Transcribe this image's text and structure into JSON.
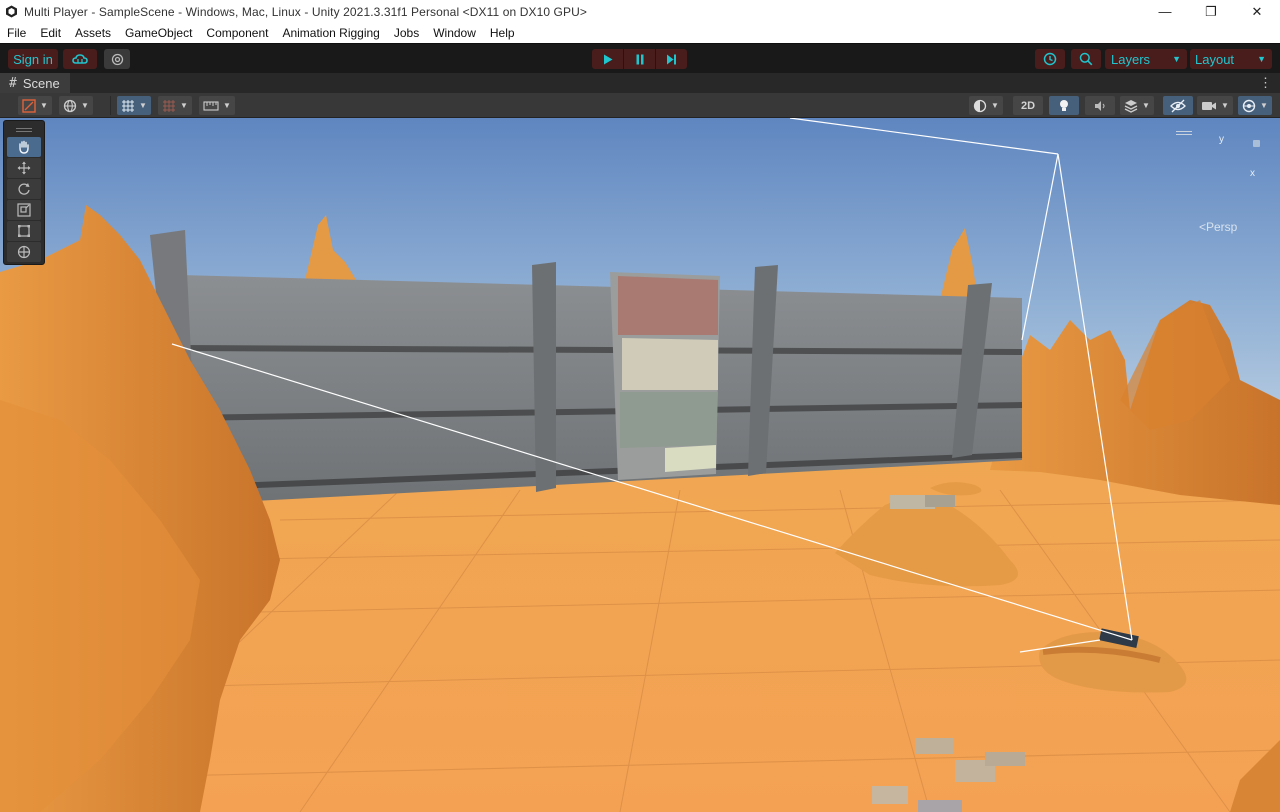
{
  "window": {
    "title": "Multi Player - SampleScene - Windows, Mac, Linux - Unity 2021.3.31f1 Personal <DX11 on DX10 GPU>",
    "controls": {
      "minimize": "—",
      "maximize": "❐",
      "close": "✕"
    }
  },
  "menubar": {
    "items": [
      "File",
      "Edit",
      "Assets",
      "GameObject",
      "Component",
      "Animation Rigging",
      "Jobs",
      "Window",
      "Help"
    ]
  },
  "toolbar": {
    "sign_in": "Sign in",
    "layers": "Layers",
    "layout": "Layout",
    "colors": {
      "background": "#191919",
      "accent": "#1fc4cc",
      "playmode_tint": "#4a1d1d"
    }
  },
  "scene_tab": {
    "label": "Scene"
  },
  "scene_toolbar": {
    "two_d": "2D"
  },
  "viewport": {
    "persp_label": "<Persp",
    "gizmo_y": "y",
    "gizmo_x": "x"
  }
}
